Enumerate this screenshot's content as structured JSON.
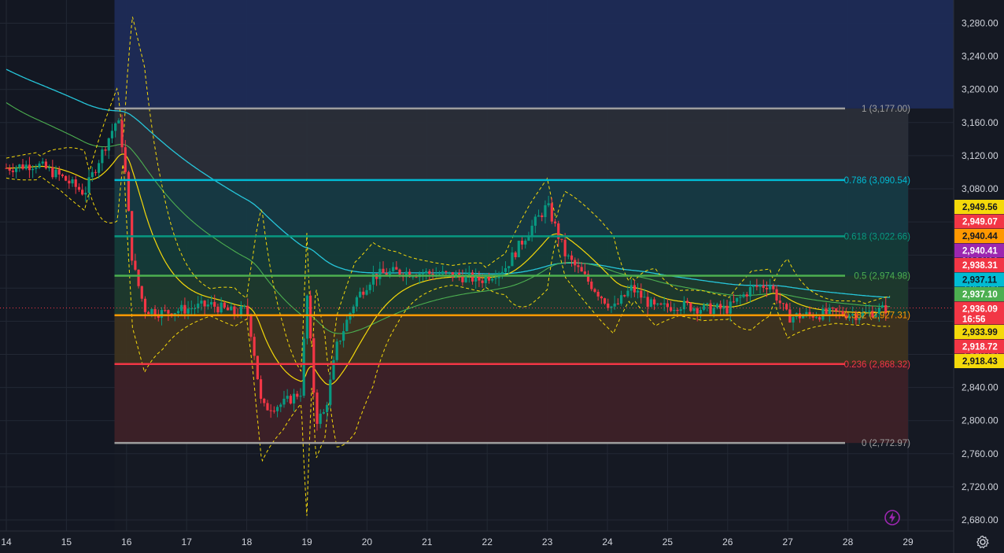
{
  "chart_data": {
    "type": "candlestick",
    "y_axis": {
      "range": [
        2665,
        3300
      ],
      "ticks": [
        "3,280.00",
        "3,240.00",
        "3,200.00",
        "3,160.00",
        "3,120.00",
        "3,080.00",
        "3,040.00",
        "3,000.00",
        "2,960.00",
        "2,920.00",
        "2,880.00",
        "2,840.00",
        "2,800.00",
        "2,760.00",
        "2,720.00",
        "2,680.00"
      ],
      "tick_values": [
        3280,
        3240,
        3200,
        3160,
        3120,
        3080,
        3040,
        3000,
        2960,
        2920,
        2880,
        2840,
        2800,
        2760,
        2720,
        2680
      ]
    },
    "x_axis": {
      "labels": [
        "14",
        "15",
        "16",
        "17",
        "18",
        "19",
        "20",
        "21",
        "22",
        "23",
        "24",
        "25",
        "26",
        "27",
        "28",
        "29"
      ],
      "day_values": [
        14,
        15,
        16,
        17,
        18,
        19,
        20,
        21,
        22,
        23,
        24,
        25,
        26,
        27,
        28,
        29
      ],
      "range": [
        14.0,
        29.8
      ]
    },
    "grid": true,
    "fibonacci": {
      "start_day": 15.8,
      "end_day": 29.0,
      "levels": [
        {
          "ratio": 1,
          "price": 3177.0,
          "label": "1 (3,177.00)",
          "color": "#9e9e9e",
          "fill": "#2a2e39"
        },
        {
          "ratio": 0.786,
          "price": 3090.54,
          "label": "0.786 (3,090.54)",
          "color": "#00bcd4",
          "fill": "#163a44"
        },
        {
          "ratio": 0.618,
          "price": 3022.66,
          "label": "0.618 (3,022.66)",
          "color": "#089981",
          "fill": "#143b39"
        },
        {
          "ratio": 0.5,
          "price": 2974.98,
          "label": "0.5 (2,974.98)",
          "color": "#4caf50",
          "fill": "#1d3a2e"
        },
        {
          "ratio": 0.382,
          "price": 2927.31,
          "label": "0.382 (2,927.31)",
          "color": "#ff9800",
          "fill": "#3e3320"
        },
        {
          "ratio": 0.236,
          "price": 2868.32,
          "label": "0.236 (2,868.32)",
          "color": "#f23645",
          "fill": "#3d2128"
        },
        {
          "ratio": 0,
          "price": 2772.97,
          "label": "0 (2,772.97)",
          "color": "#9e9e9e",
          "fill": null
        }
      ],
      "upper_fill": "#1d2b57"
    },
    "price_badges": [
      {
        "text": "2,949.56",
        "bg": "#f5d90a",
        "fg": "#131722"
      },
      {
        "text": "2,949.07",
        "bg": "#f23645",
        "fg": "#ffffff"
      },
      {
        "text": "2,940.44",
        "bg": "#ff9800",
        "fg": "#131722"
      },
      {
        "text": "2,940.41",
        "bg": "#9c27b0",
        "fg": "#ffffff"
      },
      {
        "text": "2,938.31",
        "bg": "#f23645",
        "fg": "#ffffff"
      },
      {
        "text": "2,937.11",
        "bg": "#00bcd4",
        "fg": "#131722"
      },
      {
        "text": "2,937.10",
        "bg": "#4caf50",
        "fg": "#ffffff"
      },
      {
        "text": "2,936.09",
        "bg": "#f23645",
        "fg": "#ffffff",
        "sub": "16:56"
      },
      {
        "text": "2,933.99",
        "bg": "#f5d90a",
        "fg": "#131722"
      },
      {
        "text": "2,918.72",
        "bg": "#f23645",
        "fg": "#ffffff"
      },
      {
        "text": "2,918.43",
        "bg": "#f5d90a",
        "fg": "#131722"
      }
    ],
    "price_path": [
      [
        14.0,
        3105
      ],
      [
        14.5,
        3110
      ],
      [
        14.9,
        3095
      ],
      [
        15.3,
        3075
      ],
      [
        15.6,
        3125
      ],
      [
        15.85,
        3165
      ],
      [
        15.95,
        3125
      ],
      [
        16.1,
        2990
      ],
      [
        16.3,
        2935
      ],
      [
        16.6,
        2930
      ],
      [
        17.0,
        2935
      ],
      [
        17.4,
        2940
      ],
      [
        17.8,
        2930
      ],
      [
        18.0,
        2935
      ],
      [
        18.1,
        2895
      ],
      [
        18.25,
        2815
      ],
      [
        18.6,
        2820
      ],
      [
        18.9,
        2835
      ],
      [
        19.0,
        2955
      ],
      [
        19.15,
        2800
      ],
      [
        19.3,
        2810
      ],
      [
        19.5,
        2890
      ],
      [
        19.8,
        2945
      ],
      [
        20.1,
        2975
      ],
      [
        20.5,
        2980
      ],
      [
        21.0,
        2978
      ],
      [
        21.5,
        2975
      ],
      [
        21.9,
        2970
      ],
      [
        22.3,
        2985
      ],
      [
        22.7,
        3030
      ],
      [
        23.0,
        3060
      ],
      [
        23.3,
        3000
      ],
      [
        23.6,
        2975
      ],
      [
        23.9,
        2950
      ],
      [
        24.1,
        2935
      ],
      [
        24.4,
        2960
      ],
      [
        24.8,
        2935
      ],
      [
        25.2,
        2940
      ],
      [
        25.6,
        2935
      ],
      [
        26.0,
        2935
      ],
      [
        26.4,
        2960
      ],
      [
        26.7,
        2965
      ],
      [
        27.0,
        2925
      ],
      [
        27.4,
        2928
      ],
      [
        27.8,
        2930
      ],
      [
        28.2,
        2928
      ],
      [
        28.5,
        2933
      ],
      [
        28.7,
        2936
      ]
    ]
  },
  "ui": {
    "settings_icon": "gear-icon",
    "flash_icon": "lightning-icon",
    "colors": {
      "up": "#089981",
      "down": "#f23645",
      "bg": "#151923",
      "grid": "#232834"
    }
  }
}
